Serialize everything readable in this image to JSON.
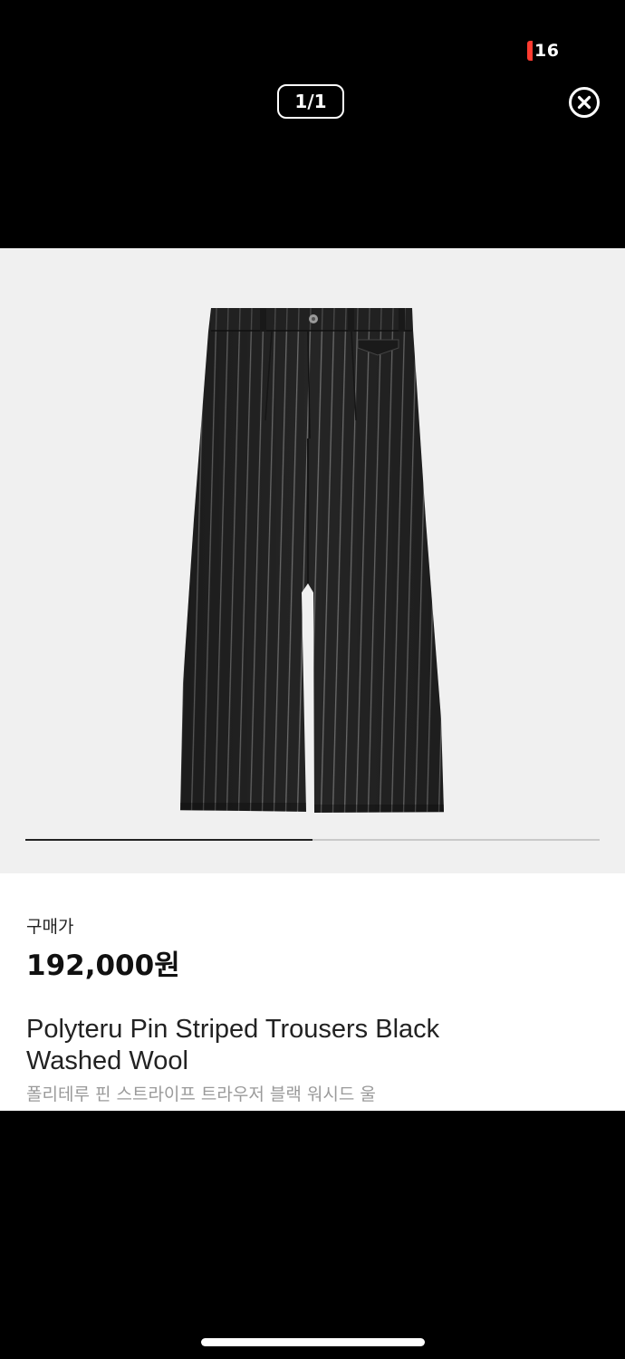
{
  "status_bar": {
    "battery_level": "16",
    "battery_color": "#ff3b30"
  },
  "viewer": {
    "page_counter": "1/1",
    "close_icon": "close-circle-icon",
    "carousel_progress": 0.5
  },
  "product": {
    "image_icon": "striped-trousers-photo",
    "price_label": "구매가",
    "price": "192,000원",
    "name_en": "Polyteru Pin Striped Trousers Black Washed Wool",
    "name_ko": "폴리테루 핀 스트라이프 트라우저 블랙 워시드 울"
  },
  "colors": {
    "background": "#000000",
    "image_background": "#f0f0f0",
    "panel_background": "#ffffff",
    "price_text": "#111111",
    "subtitle_text": "#9a9a9a"
  }
}
